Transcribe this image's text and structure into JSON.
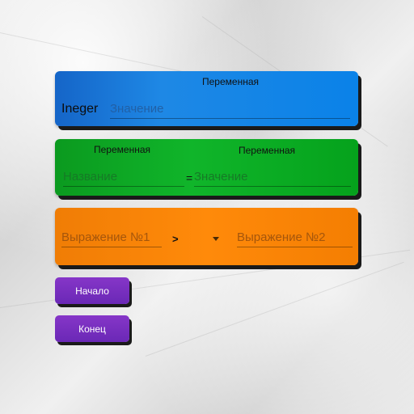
{
  "integer_block": {
    "type_label": "Ineger",
    "variable_label": "Переменная",
    "value_placeholder": "Значение",
    "color": "#1e88e5"
  },
  "assign_block": {
    "left_label": "Переменная",
    "right_label": "Переменная",
    "name_placeholder": "Название",
    "equals": "=",
    "value_placeholder": "Значение",
    "color": "#10b52a"
  },
  "compare_block": {
    "expr1_placeholder": "Выражение №1",
    "operator": ">",
    "expr2_placeholder": "Выражение №2",
    "operator_dropdown_icon": "chevron-down-icon",
    "color": "#ff8a0a"
  },
  "buttons": {
    "start_label": "Начало",
    "end_label": "Конец",
    "color": "#7a2fc0"
  }
}
